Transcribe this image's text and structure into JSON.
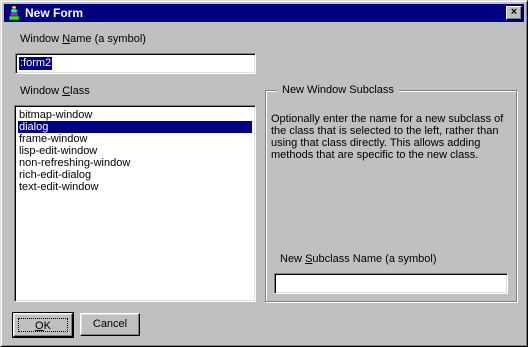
{
  "window": {
    "title": "New Form",
    "close_label": "×"
  },
  "name_section": {
    "label_pre": "Window ",
    "label_accel": "N",
    "label_post": "ame (a symbol)",
    "value": ":form2"
  },
  "class_section": {
    "label_pre": "Window ",
    "label_accel": "C",
    "label_post": "lass",
    "items": [
      {
        "label": "bitmap-window",
        "selected": false
      },
      {
        "label": "dialog",
        "selected": true
      },
      {
        "label": "frame-window",
        "selected": false
      },
      {
        "label": "lisp-edit-window",
        "selected": false
      },
      {
        "label": "non-refreshing-window",
        "selected": false
      },
      {
        "label": "rich-edit-dialog",
        "selected": false
      },
      {
        "label": "text-edit-window",
        "selected": false
      }
    ]
  },
  "subclass_group": {
    "title": "New Window Subclass",
    "description": "Optionally enter the name for a new subclass of the class that is selected to the left, rather than using that class directly.  This allows adding methods that are specific to the new class.",
    "field_label_pre": "New ",
    "field_label_accel": "S",
    "field_label_post": "ubclass Name (a symbol)",
    "field_value": ""
  },
  "buttons": {
    "ok_accel": "O",
    "ok_post": "K",
    "cancel": "Cancel"
  },
  "colors": {
    "titlebar": "#000080",
    "selection": "#000080",
    "face": "#c0c0c0"
  }
}
